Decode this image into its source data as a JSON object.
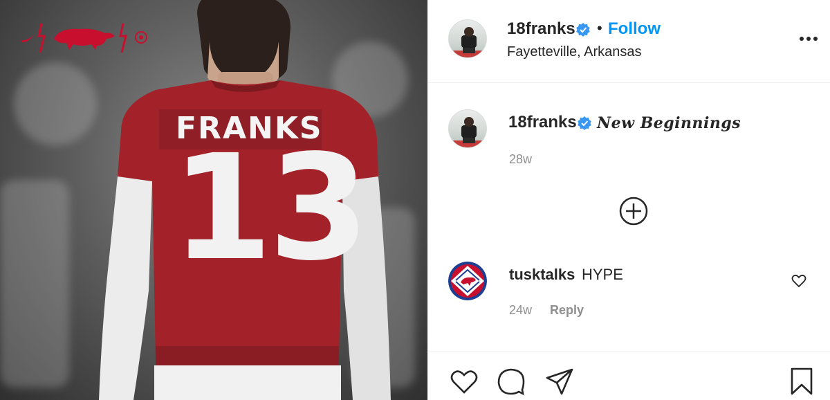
{
  "photo": {
    "jersey_name": "FRANKS",
    "jersey_number": "13",
    "logo_icons": [
      "nike-swoosh-icon",
      "razorback-hog-icon",
      "sec-logo-icon"
    ],
    "colors": {
      "jersey_red": "#a3222a",
      "logo_red": "#c8102e"
    }
  },
  "post": {
    "author": {
      "username": "18franks",
      "verified": true,
      "follow_label": "Follow",
      "location": "Fayetteville, Arkansas"
    },
    "caption": {
      "username": "18franks",
      "text": "New Beginnings",
      "time": "28w"
    },
    "load_more_icon": "plus-circle-icon",
    "comments": [
      {
        "username": "tusktalks",
        "text": "HYPE",
        "time": "24w",
        "reply_label": "Reply"
      }
    ],
    "actions": [
      "heart-icon",
      "comment-icon",
      "share-icon",
      "bookmark-icon"
    ]
  },
  "colors": {
    "accent": "#0095f6",
    "muted": "#8e8e8e",
    "text": "#262626",
    "divider": "#efefef"
  }
}
